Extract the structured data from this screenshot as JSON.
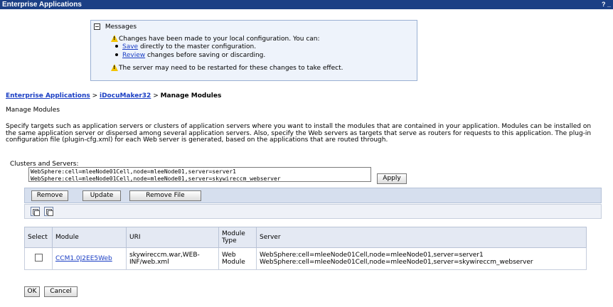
{
  "window": {
    "title": "Enterprise Applications",
    "controls": "? _"
  },
  "messages": {
    "header": "Messages",
    "line1": "Changes have been made to your local configuration. You can:",
    "save_link": "Save",
    "save_text": " directly to the master configuration.",
    "review_link": "Review",
    "review_text": " changes before saving or discarding.",
    "warning": "The server may need to be restarted for these changes to take effect."
  },
  "breadcrumb": {
    "root": "Enterprise Applications",
    "sep1": " > ",
    "app": "iDocuMaker32",
    "sep2": " > ",
    "current": "Manage Modules"
  },
  "page": {
    "subtitle": "Manage Modules",
    "description": "Specify targets such as application servers or clusters of application servers where you want to install the modules that are contained in your application. Modules can be installed on the same application server or dispersed among several application servers. Also, specify the Web servers as targets that serve as routers for requests to this application. The plug-in configuration file (plugin-cfg.xml) for each Web server is generated, based on the applications that are routed through."
  },
  "clusters": {
    "label": "Clusters and Servers:",
    "options": [
      "WebSphere:cell=mleeNode01Cell,node=mleeNode01,server=server1",
      "WebSphere:cell=mleeNode01Cell,node=mleeNode01,server=skywireccm_webserver"
    ],
    "apply_label": "Apply"
  },
  "toolbar": {
    "remove_label": "Remove",
    "update_label": "Update",
    "remove_file_label": "Remove File"
  },
  "icons": {
    "select_all": "select-all-icon",
    "deselect_all": "deselect-all-icon"
  },
  "table": {
    "headers": {
      "select": "Select",
      "module": "Module",
      "uri": "URI",
      "type": "Module Type",
      "server": "Server"
    },
    "rows": [
      {
        "module": "CCM1.0J2EE5Web",
        "uri": "skywireccm.war,WEB-INF/web.xml",
        "type": "Web Module",
        "server1": "WebSphere:cell=mleeNode01Cell,node=mleeNode01,server=server1",
        "server2": "WebSphere:cell=mleeNode01Cell,node=mleeNode01,server=skywireccm_webserver"
      }
    ]
  },
  "footer": {
    "ok_label": "OK",
    "cancel_label": "Cancel"
  },
  "colors": {
    "titlebar": "#1b3f85",
    "link": "#1a3ec4",
    "message_bg": "#eef3fb",
    "toolbar_bg": "#d6dfee"
  }
}
